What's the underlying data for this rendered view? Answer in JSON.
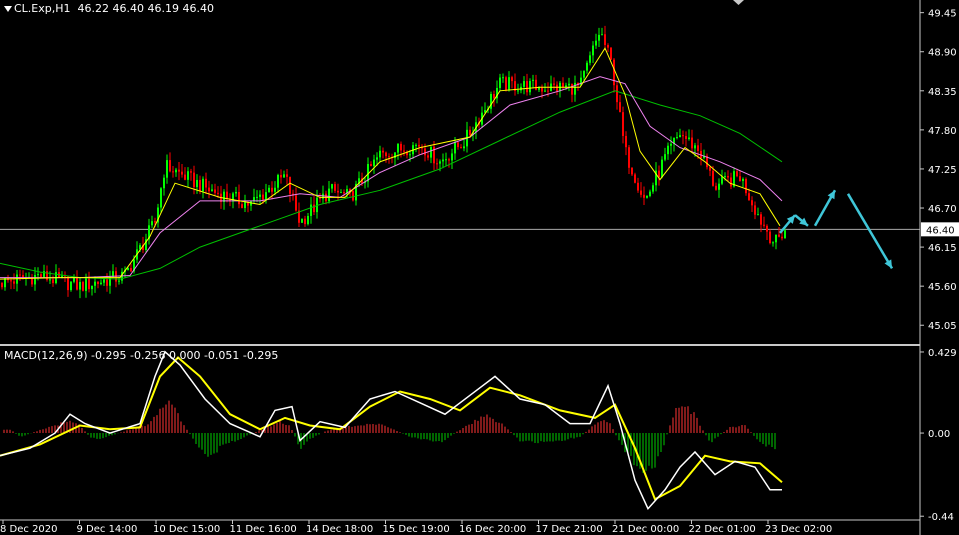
{
  "header": {
    "symbol_info": "CL.Exp,H1  46.22 46.40 46.19 46.40",
    "macd_info": "MACD(12,26,9) -0.295 -0.256 0.000 -0.051 -0.295"
  },
  "chart_data": [
    {
      "type": "candlestick",
      "symbol": "CL.Exp",
      "timeframe": "H1",
      "ohlc_last": {
        "open": 46.22,
        "high": 46.4,
        "low": 46.19,
        "close": 46.4
      },
      "current_price": "46.40",
      "y_ticks": [
        "49.45",
        "48.90",
        "48.35",
        "47.80",
        "47.25",
        "46.70",
        "46.15",
        "45.60",
        "45.05"
      ],
      "ylim": [
        44.8,
        49.6
      ],
      "x_ticks": [
        "8 Dec 2020",
        "9 Dec 14:00",
        "10 Dec 15:00",
        "11 Dec 16:00",
        "14 Dec 18:00",
        "15 Dec 19:00",
        "16 Dec 20:00",
        "17 Dec 21:00",
        "21 Dec 00:00",
        "22 Dec 01:00",
        "23 Dec 02:00"
      ],
      "price_path": [
        {
          "x": 0,
          "y": 45.65
        },
        {
          "x": 40,
          "y": 45.75
        },
        {
          "x": 80,
          "y": 45.6
        },
        {
          "x": 125,
          "y": 45.75
        },
        {
          "x": 155,
          "y": 46.5
        },
        {
          "x": 165,
          "y": 47.3
        },
        {
          "x": 210,
          "y": 46.95
        },
        {
          "x": 250,
          "y": 46.75
        },
        {
          "x": 285,
          "y": 47.15
        },
        {
          "x": 300,
          "y": 46.5
        },
        {
          "x": 330,
          "y": 46.95
        },
        {
          "x": 350,
          "y": 46.85
        },
        {
          "x": 380,
          "y": 47.45
        },
        {
          "x": 420,
          "y": 47.6
        },
        {
          "x": 440,
          "y": 47.35
        },
        {
          "x": 465,
          "y": 47.65
        },
        {
          "x": 500,
          "y": 48.45
        },
        {
          "x": 540,
          "y": 48.4
        },
        {
          "x": 580,
          "y": 48.4
        },
        {
          "x": 600,
          "y": 49.2
        },
        {
          "x": 612,
          "y": 48.7
        },
        {
          "x": 625,
          "y": 47.5
        },
        {
          "x": 645,
          "y": 46.8
        },
        {
          "x": 665,
          "y": 47.4
        },
        {
          "x": 680,
          "y": 47.75
        },
        {
          "x": 700,
          "y": 47.5
        },
        {
          "x": 715,
          "y": 47.0
        },
        {
          "x": 740,
          "y": 47.15
        },
        {
          "x": 760,
          "y": 46.55
        },
        {
          "x": 775,
          "y": 46.2
        },
        {
          "x": 785,
          "y": 46.4
        }
      ],
      "ma_fast": [
        {
          "x": 0,
          "y": 45.7
        },
        {
          "x": 60,
          "y": 45.72
        },
        {
          "x": 120,
          "y": 45.72
        },
        {
          "x": 150,
          "y": 46.3
        },
        {
          "x": 175,
          "y": 47.05
        },
        {
          "x": 220,
          "y": 46.85
        },
        {
          "x": 260,
          "y": 46.75
        },
        {
          "x": 290,
          "y": 47.05
        },
        {
          "x": 320,
          "y": 46.85
        },
        {
          "x": 345,
          "y": 46.85
        },
        {
          "x": 380,
          "y": 47.35
        },
        {
          "x": 420,
          "y": 47.55
        },
        {
          "x": 470,
          "y": 47.7
        },
        {
          "x": 500,
          "y": 48.35
        },
        {
          "x": 540,
          "y": 48.4
        },
        {
          "x": 580,
          "y": 48.4
        },
        {
          "x": 605,
          "y": 48.95
        },
        {
          "x": 625,
          "y": 48.3
        },
        {
          "x": 640,
          "y": 47.5
        },
        {
          "x": 660,
          "y": 47.1
        },
        {
          "x": 685,
          "y": 47.55
        },
        {
          "x": 705,
          "y": 47.35
        },
        {
          "x": 730,
          "y": 47.05
        },
        {
          "x": 760,
          "y": 46.9
        },
        {
          "x": 780,
          "y": 46.45
        }
      ],
      "ma_mid": [
        {
          "x": 0,
          "y": 45.72
        },
        {
          "x": 80,
          "y": 45.72
        },
        {
          "x": 130,
          "y": 45.75
        },
        {
          "x": 160,
          "y": 46.35
        },
        {
          "x": 200,
          "y": 46.8
        },
        {
          "x": 260,
          "y": 46.8
        },
        {
          "x": 300,
          "y": 46.9
        },
        {
          "x": 340,
          "y": 46.85
        },
        {
          "x": 380,
          "y": 47.2
        },
        {
          "x": 420,
          "y": 47.45
        },
        {
          "x": 470,
          "y": 47.7
        },
        {
          "x": 510,
          "y": 48.15
        },
        {
          "x": 560,
          "y": 48.35
        },
        {
          "x": 600,
          "y": 48.55
        },
        {
          "x": 625,
          "y": 48.45
        },
        {
          "x": 650,
          "y": 47.85
        },
        {
          "x": 680,
          "y": 47.55
        },
        {
          "x": 720,
          "y": 47.35
        },
        {
          "x": 760,
          "y": 47.1
        },
        {
          "x": 782,
          "y": 46.8
        }
      ],
      "ma_slow": [
        {
          "x": 0,
          "y": 45.92
        },
        {
          "x": 40,
          "y": 45.8
        },
        {
          "x": 80,
          "y": 45.72
        },
        {
          "x": 120,
          "y": 45.7
        },
        {
          "x": 160,
          "y": 45.85
        },
        {
          "x": 200,
          "y": 46.15
        },
        {
          "x": 260,
          "y": 46.45
        },
        {
          "x": 320,
          "y": 46.75
        },
        {
          "x": 380,
          "y": 46.95
        },
        {
          "x": 440,
          "y": 47.25
        },
        {
          "x": 500,
          "y": 47.65
        },
        {
          "x": 560,
          "y": 48.05
        },
        {
          "x": 615,
          "y": 48.35
        },
        {
          "x": 660,
          "y": 48.15
        },
        {
          "x": 700,
          "y": 48.0
        },
        {
          "x": 740,
          "y": 47.75
        },
        {
          "x": 782,
          "y": 47.35
        }
      ],
      "forecast_arrows": [
        {
          "from": {
            "x": 780,
            "y": 46.35
          },
          "to": {
            "x": 795,
            "y": 46.6
          }
        },
        {
          "from": {
            "x": 795,
            "y": 46.6
          },
          "to": {
            "x": 808,
            "y": 46.45
          }
        },
        {
          "from": {
            "x": 815,
            "y": 46.45
          },
          "to": {
            "x": 835,
            "y": 46.95
          }
        },
        {
          "from": {
            "x": 848,
            "y": 46.9
          },
          "to": {
            "x": 892,
            "y": 45.85
          }
        }
      ],
      "colors": {
        "bull": "#00ff00",
        "bear": "#ff0000",
        "ma_fast": "#ffff00",
        "ma_mid": "#ee82ee",
        "ma_slow": "#00c000",
        "arrows": "#3fc6d8",
        "price_line": "#aaaaaa"
      }
    },
    {
      "type": "macd",
      "title": "MACD(12,26,9)",
      "values_printed": [
        "-0.295",
        "-0.256",
        "0.000",
        "-0.051",
        "-0.295"
      ],
      "y_ticks": [
        "0.429",
        "0.00",
        "-0.44"
      ],
      "ylim": [
        -0.46,
        0.45
      ],
      "macd_line": [
        {
          "x": 0,
          "y": -0.12
        },
        {
          "x": 30,
          "y": -0.08
        },
        {
          "x": 55,
          "y": 0.0
        },
        {
          "x": 70,
          "y": 0.1
        },
        {
          "x": 85,
          "y": 0.05
        },
        {
          "x": 110,
          "y": 0.0
        },
        {
          "x": 140,
          "y": 0.05
        },
        {
          "x": 155,
          "y": 0.3
        },
        {
          "x": 165,
          "y": 0.43
        },
        {
          "x": 180,
          "y": 0.36
        },
        {
          "x": 205,
          "y": 0.18
        },
        {
          "x": 230,
          "y": 0.05
        },
        {
          "x": 260,
          "y": -0.02
        },
        {
          "x": 275,
          "y": 0.12
        },
        {
          "x": 292,
          "y": 0.14
        },
        {
          "x": 300,
          "y": -0.04
        },
        {
          "x": 320,
          "y": 0.06
        },
        {
          "x": 345,
          "y": 0.03
        },
        {
          "x": 370,
          "y": 0.18
        },
        {
          "x": 395,
          "y": 0.22
        },
        {
          "x": 420,
          "y": 0.16
        },
        {
          "x": 445,
          "y": 0.1
        },
        {
          "x": 470,
          "y": 0.2
        },
        {
          "x": 495,
          "y": 0.3
        },
        {
          "x": 520,
          "y": 0.18
        },
        {
          "x": 545,
          "y": 0.15
        },
        {
          "x": 570,
          "y": 0.05
        },
        {
          "x": 590,
          "y": 0.05
        },
        {
          "x": 608,
          "y": 0.25
        },
        {
          "x": 620,
          "y": 0.05
        },
        {
          "x": 635,
          "y": -0.25
        },
        {
          "x": 648,
          "y": -0.4
        },
        {
          "x": 665,
          "y": -0.3
        },
        {
          "x": 680,
          "y": -0.18
        },
        {
          "x": 695,
          "y": -0.1
        },
        {
          "x": 715,
          "y": -0.22
        },
        {
          "x": 735,
          "y": -0.15
        },
        {
          "x": 755,
          "y": -0.18
        },
        {
          "x": 770,
          "y": -0.3
        },
        {
          "x": 782,
          "y": -0.3
        }
      ],
      "signal_line": [
        {
          "x": 0,
          "y": -0.12
        },
        {
          "x": 40,
          "y": -0.06
        },
        {
          "x": 80,
          "y": 0.04
        },
        {
          "x": 110,
          "y": 0.02
        },
        {
          "x": 140,
          "y": 0.03
        },
        {
          "x": 160,
          "y": 0.3
        },
        {
          "x": 178,
          "y": 0.4
        },
        {
          "x": 200,
          "y": 0.3
        },
        {
          "x": 230,
          "y": 0.1
        },
        {
          "x": 260,
          "y": 0.02
        },
        {
          "x": 285,
          "y": 0.08
        },
        {
          "x": 310,
          "y": 0.04
        },
        {
          "x": 340,
          "y": 0.02
        },
        {
          "x": 370,
          "y": 0.14
        },
        {
          "x": 400,
          "y": 0.22
        },
        {
          "x": 430,
          "y": 0.18
        },
        {
          "x": 460,
          "y": 0.12
        },
        {
          "x": 490,
          "y": 0.24
        },
        {
          "x": 520,
          "y": 0.2
        },
        {
          "x": 560,
          "y": 0.12
        },
        {
          "x": 595,
          "y": 0.08
        },
        {
          "x": 615,
          "y": 0.15
        },
        {
          "x": 635,
          "y": -0.08
        },
        {
          "x": 655,
          "y": -0.35
        },
        {
          "x": 680,
          "y": -0.28
        },
        {
          "x": 705,
          "y": -0.12
        },
        {
          "x": 730,
          "y": -0.15
        },
        {
          "x": 760,
          "y": -0.16
        },
        {
          "x": 782,
          "y": -0.26
        }
      ],
      "histogram_bars": [
        {
          "x": 10,
          "y": 0.02
        },
        {
          "x": 20,
          "y": -0.02
        },
        {
          "x": 60,
          "y": 0.05
        },
        {
          "x": 70,
          "y": 0.06
        },
        {
          "x": 80,
          "y": 0.04
        },
        {
          "x": 90,
          "y": -0.02
        },
        {
          "x": 100,
          "y": -0.03
        },
        {
          "x": 150,
          "y": 0.05
        },
        {
          "x": 160,
          "y": 0.12
        },
        {
          "x": 170,
          "y": 0.18
        },
        {
          "x": 180,
          "y": 0.08
        },
        {
          "x": 195,
          "y": -0.05
        },
        {
          "x": 210,
          "y": -0.12
        },
        {
          "x": 225,
          "y": -0.06
        },
        {
          "x": 240,
          "y": -0.03
        },
        {
          "x": 280,
          "y": 0.06
        },
        {
          "x": 290,
          "y": 0.04
        },
        {
          "x": 300,
          "y": -0.08
        },
        {
          "x": 310,
          "y": -0.03
        },
        {
          "x": 330,
          "y": 0.02
        },
        {
          "x": 370,
          "y": 0.05
        },
        {
          "x": 385,
          "y": 0.04
        },
        {
          "x": 410,
          "y": -0.02
        },
        {
          "x": 440,
          "y": -0.05
        },
        {
          "x": 470,
          "y": 0.05
        },
        {
          "x": 485,
          "y": 0.09
        },
        {
          "x": 500,
          "y": 0.06
        },
        {
          "x": 520,
          "y": -0.04
        },
        {
          "x": 540,
          "y": -0.05
        },
        {
          "x": 560,
          "y": -0.04
        },
        {
          "x": 580,
          "y": -0.02
        },
        {
          "x": 600,
          "y": 0.07
        },
        {
          "x": 610,
          "y": 0.05
        },
        {
          "x": 625,
          "y": -0.1
        },
        {
          "x": 640,
          "y": -0.18
        },
        {
          "x": 650,
          "y": -0.2
        },
        {
          "x": 660,
          "y": -0.12
        },
        {
          "x": 675,
          "y": 0.12
        },
        {
          "x": 685,
          "y": 0.16
        },
        {
          "x": 695,
          "y": 0.09
        },
        {
          "x": 710,
          "y": -0.05
        },
        {
          "x": 730,
          "y": 0.03
        },
        {
          "x": 745,
          "y": 0.04
        },
        {
          "x": 760,
          "y": -0.05
        },
        {
          "x": 775,
          "y": -0.08
        }
      ],
      "colors": {
        "macd": "#ffffff",
        "signal": "#ffff00",
        "hist_pos": "#ff3333",
        "hist_neg": "#00cc00"
      }
    }
  ]
}
